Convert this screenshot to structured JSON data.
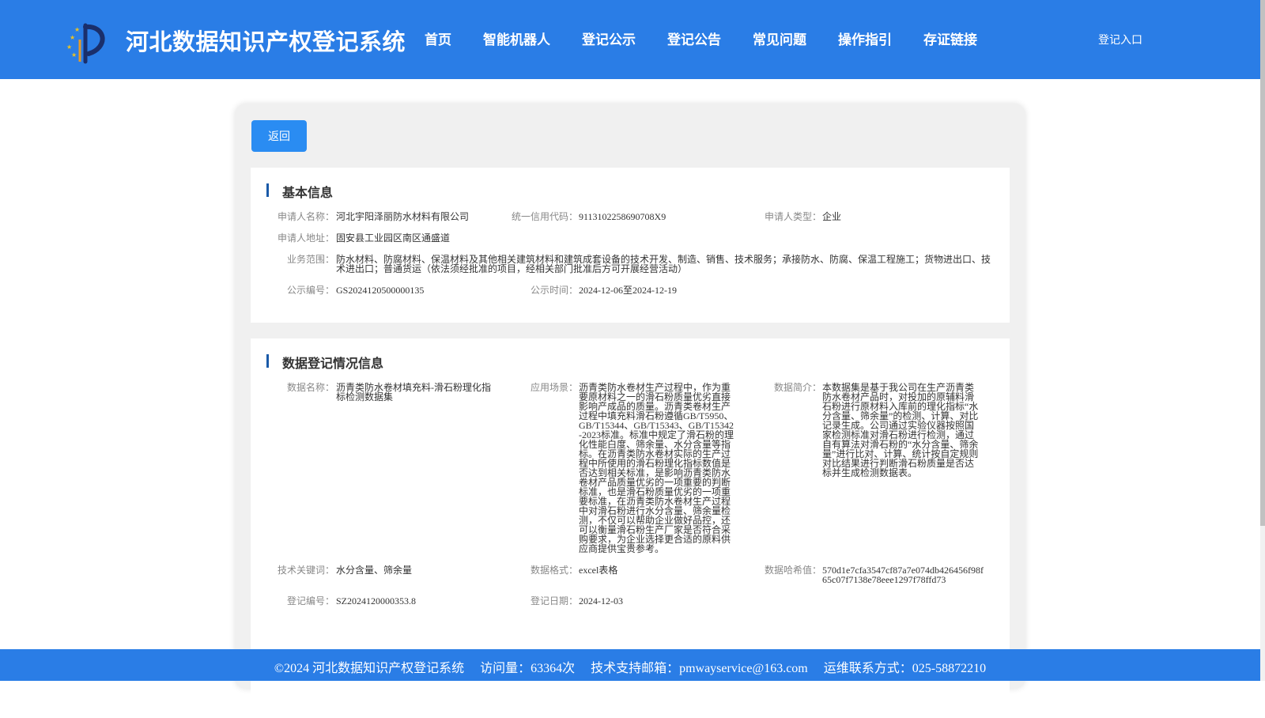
{
  "header": {
    "title": "河北数据知识产权登记系统",
    "nav": [
      "首页",
      "智能机器人",
      "登记公示",
      "登记公告",
      "常见问题",
      "操作指引",
      "存证链接"
    ],
    "login": "登记入口"
  },
  "back_button": "返回",
  "basic_info": {
    "title": "基本信息",
    "applicant_name_label": "申请人名称：",
    "applicant_name": "河北宇阳泽丽防水材料有限公司",
    "credit_code_label": "统一信用代码：",
    "credit_code": "9113102258690708X9",
    "applicant_type_label": "申请人类型：",
    "applicant_type": "企业",
    "address_label": "申请人地址：",
    "address": "固安县工业园区南区通盛道",
    "scope_label": "业务范围：",
    "scope": "防水材料、防腐材料、保温材料及其他相关建筑材料和建筑成套设备的技术开发、制造、销售、技术服务；承接防水、防腐、保温工程施工；货物进出口、技术进出口；普通货运（依法须经批准的项目，经相关部门批准后方可开展经营活动）",
    "notice_no_label": "公示编号：",
    "notice_no": "GS2024120500000135",
    "notice_time_label": "公示时间：",
    "notice_time": "2024-12-06至2024-12-19"
  },
  "data_info": {
    "title": "数据登记情况信息",
    "data_name_label": "数据名称：",
    "data_name": "沥青类防水卷材填充料-滑石粉理化指标检测数据集",
    "scenario_label": "应用场景：",
    "scenario": "沥青类防水卷材生产过程中，作为重要原材料之一的滑石粉质量优劣直接影响产成品的质量。沥青类卷材生产过程中填充料滑石粉遵循GB/T5950、GB/T15344、GB/T15343、GB/T15342-2023标准。标准中规定了滑石粉的理化性能白度、筛余量、水分含量等指标。在沥青类防水卷材实际的生产过程中所使用的滑石粉理化指标数值是否达到相关标准，是影响沥青类防水卷材产品质量优劣的一项重要的判断标准，也是滑石粉质量优劣的一项重要标准，在沥青类防水卷材生产过程中对滑石粉进行水分含量、筛余量检测，不仅可以帮助企业做好品控，还可以衡量滑石粉生产厂家是否符合采购要求，为企业选择更合适的原料供应商提供宝贵参考。",
    "intro_label": "数据简介：",
    "intro": "本数据集是基于我公司在生产沥青类防水卷材产品时，对投加的原辅料滑石粉进行原材料入库前的理化指标“水分含量、筛余量”的检测、计算、对比记录生成。公司通过实验仪器按照国家检测标准对滑石粉进行检测，通过自有算法对滑石粉的“水分含量、筛余量”进行比对、计算、统计按自定规则对比结果进行判断滑石粉质量是否达标并生成检测数据表。",
    "keywords_label": "技术关键词：",
    "keywords": "水分含量、筛余量",
    "format_label": "数据格式：",
    "format": "excel表格",
    "hash_label": "数据哈希值：",
    "hash": "570d1e7cfa3547cf87a7e074db426456f98f65c07f7138e78eee1297f78ffd73",
    "reg_no_label": "登记编号：",
    "reg_no": "SZ2024120000353.8",
    "reg_date_label": "登记日期：",
    "reg_date": "2024-12-03"
  },
  "footer": {
    "text": "©2024 河北数据知识产权登记系统     访问量：63364次     技术支持邮箱：pmwayservice@163.com     运维联系方式：025-58872210"
  },
  "colors": {
    "primary": "#2a7de6",
    "button": "#2a8cf2",
    "accent_bar": "#1a5aa8"
  }
}
